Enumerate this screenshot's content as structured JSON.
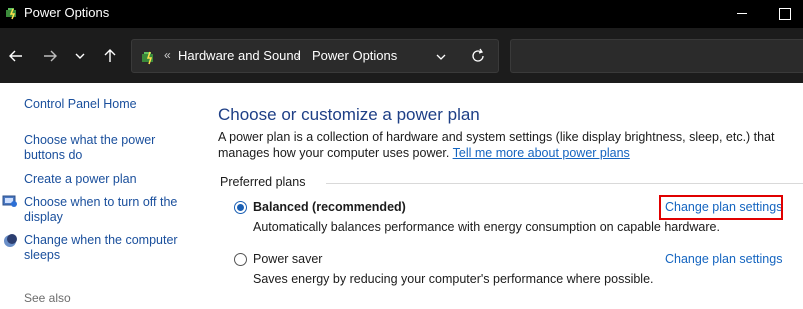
{
  "window": {
    "title": "Power Options"
  },
  "address": {
    "separator_prefix": "«",
    "crumbs": [
      "Hardware and Sound",
      "Power Options"
    ],
    "crumb_separator": "›"
  },
  "sidebar": {
    "items": [
      {
        "label": "Control Panel Home"
      },
      {
        "label": "Choose what the power buttons do"
      },
      {
        "label": "Create a power plan"
      },
      {
        "label": "Choose when to turn off the display"
      },
      {
        "label": "Change when the computer sleeps"
      }
    ],
    "see_also": "See also"
  },
  "main": {
    "title": "Choose or customize a power plan",
    "description": "A power plan is a collection of hardware and system settings (like display brightness, sleep, etc.) that manages how your computer uses power.",
    "more_link": "Tell me more about power plans",
    "group_label": "Preferred plans",
    "plans": [
      {
        "name": "Balanced (recommended)",
        "description": "Automatically balances performance with energy consumption on capable hardware.",
        "link": "Change plan settings",
        "selected": true
      },
      {
        "name": "Power saver",
        "description": "Saves energy by reducing your computer's performance where possible.",
        "link": "Change plan settings",
        "selected": false
      }
    ]
  },
  "colors": {
    "accent": "#1a5fb4",
    "link": "#1565c0",
    "highlight": "#e00000"
  }
}
